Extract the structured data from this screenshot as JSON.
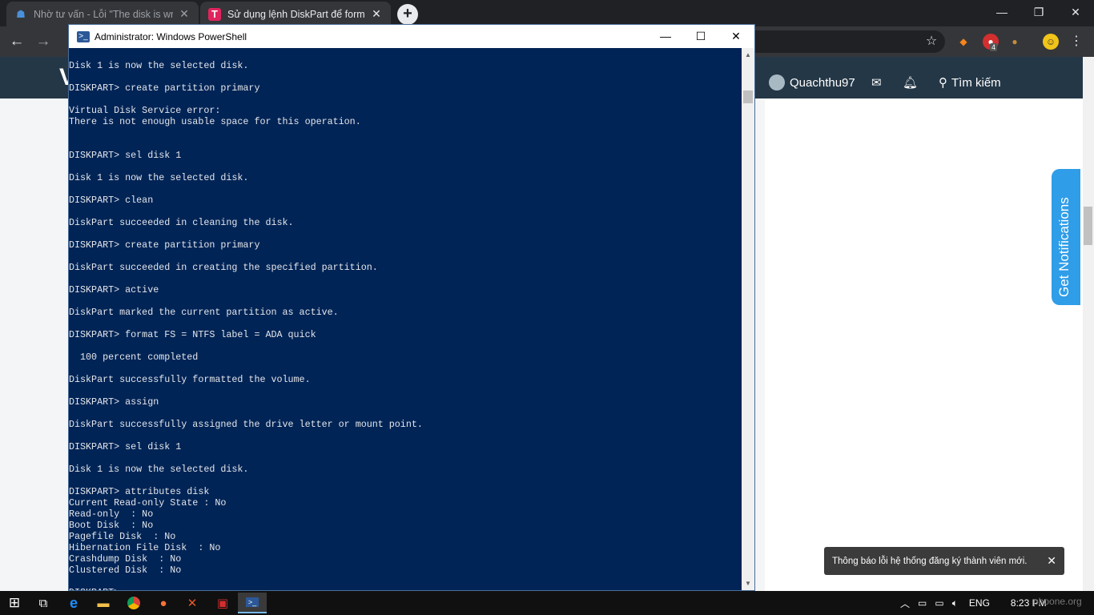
{
  "browser": {
    "tabs": [
      {
        "title": "Nhờ tư vấn - Lỗi \"The disk is write protected\"",
        "close": "✕"
      },
      {
        "title": "Sử dụng lệnh DiskPart để format",
        "close": "✕"
      }
    ],
    "new_tab_label": "+",
    "window_controls": {
      "minimize": "—",
      "restore": "❐",
      "close": "✕"
    },
    "nav": {
      "back": "←",
      "forward": "→"
    },
    "extensions": {
      "badge_count": "4"
    }
  },
  "site": {
    "header_logo_letter": "V",
    "username": "Quachthu97",
    "search_label": "Tìm kiếm",
    "get_notifications": "Get Notifications",
    "toast_message": "Thông báo lỗi hệ thống đăng ký thành viên mới.",
    "toast_close": "✕"
  },
  "powershell": {
    "title": "Administrator: Windows PowerShell",
    "controls": {
      "minimize": "—",
      "maximize": "☐",
      "close": "✕"
    },
    "console_lines": [
      "Disk 1 is now the selected disk.",
      "",
      "DISKPART> create partition primary",
      "",
      "Virtual Disk Service error:",
      "There is not enough usable space for this operation.",
      "",
      "",
      "DISKPART> sel disk 1",
      "",
      "Disk 1 is now the selected disk.",
      "",
      "DISKPART> clean",
      "",
      "DiskPart succeeded in cleaning the disk.",
      "",
      "DISKPART> create partition primary",
      "",
      "DiskPart succeeded in creating the specified partition.",
      "",
      "DISKPART> active",
      "",
      "DiskPart marked the current partition as active.",
      "",
      "DISKPART> format FS = NTFS label = ADA quick",
      "",
      "  100 percent completed",
      "",
      "DiskPart successfully formatted the volume.",
      "",
      "DISKPART> assign",
      "",
      "DiskPart successfully assigned the drive letter or mount point.",
      "",
      "DISKPART> sel disk 1",
      "",
      "Disk 1 is now the selected disk.",
      "",
      "DISKPART> attributes disk",
      "Current Read-only State : No",
      "Read-only  : No",
      "Boot Disk  : No",
      "Pagefile Disk  : No",
      "Hibernation File Disk  : No",
      "Crashdump Disk  : No",
      "Clustered Disk  : No",
      "",
      "DISKPART>"
    ]
  },
  "taskbar": {
    "language": "ENG",
    "time": "8:23 PM",
    "watermark": "phoone.org"
  },
  "colors": {
    "console_bg": "#012456",
    "site_header": "#243746",
    "notif_blue": "#2f9de8"
  }
}
